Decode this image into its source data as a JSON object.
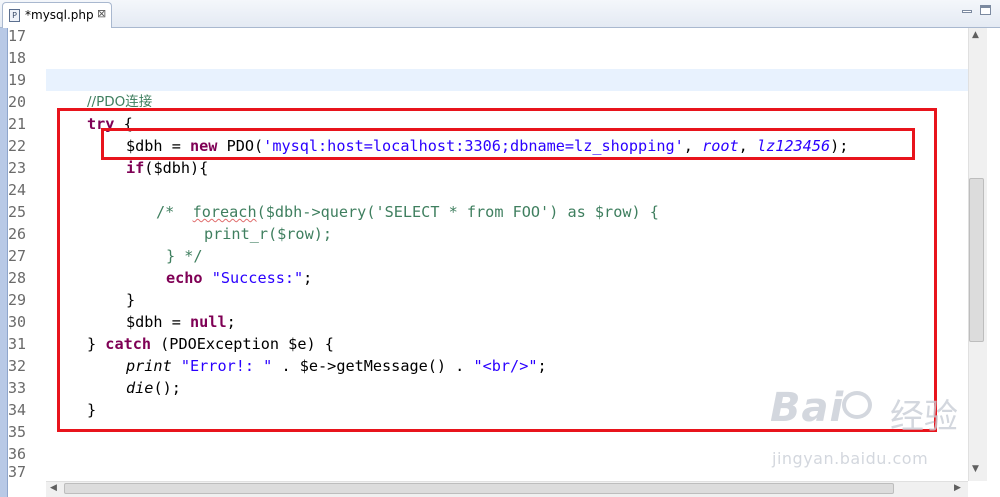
{
  "tab": {
    "title": "*mysql.php",
    "icon": "php-file-icon",
    "close_glyph": "⊠"
  },
  "line_numbers": [
    "17",
    "18",
    "19",
    "20",
    "21",
    "22",
    "23",
    "24",
    "25",
    "26",
    "27",
    "28",
    "29",
    "30",
    "31",
    "32",
    "33",
    "34",
    "35",
    "36",
    "37"
  ],
  "code": {
    "l20": "//PDO连接",
    "l21_kw": "try",
    "l21_rest": " {",
    "l22_a": "$dbh = ",
    "l22_kw": "new",
    "l22_b": " PDO(",
    "l22_str": "'mysql:host=localhost:3306;dbname=lz_shopping'",
    "l22_c": ", ",
    "l22_user": "root",
    "l22_d": ", ",
    "l22_pass": "lz123456",
    "l22_e": ");",
    "l23_kw": "if",
    "l23_rest": "($dbh){",
    "l25_a": "/*  ",
    "l25_b": "foreach",
    "l25_c": "($dbh->query('SELECT * from FOO') as $row) {",
    "l26": "print_r($row);",
    "l27": "} */",
    "l28_kw": "echo",
    "l28_sp": " ",
    "l28_str": "\"Success:\"",
    "l28_end": ";",
    "l29": "}",
    "l30_a": "$dbh = ",
    "l30_kw": "null",
    "l30_b": ";",
    "l31_a": "} ",
    "l31_kw": "catch",
    "l31_b": " (PDOException $e) {",
    "l32_fn": "print",
    "l32_sp": " ",
    "l32_str1": "\"Error!: \"",
    "l32_mid": " . $e->getMessage() . ",
    "l32_str2": "\"<br/>\"",
    "l32_end": ";",
    "l33_fn": "die",
    "l33_rest": "();",
    "l34": "}"
  },
  "watermark": {
    "logo": "Bai",
    "cn": "经验",
    "url": "jingyan.baidu.com"
  },
  "colors": {
    "keyword": "#7f0055",
    "string": "#2a00ff",
    "comment": "#3f7f5f",
    "highlight": "#e8141c",
    "current_line": "#e8f2fe"
  }
}
